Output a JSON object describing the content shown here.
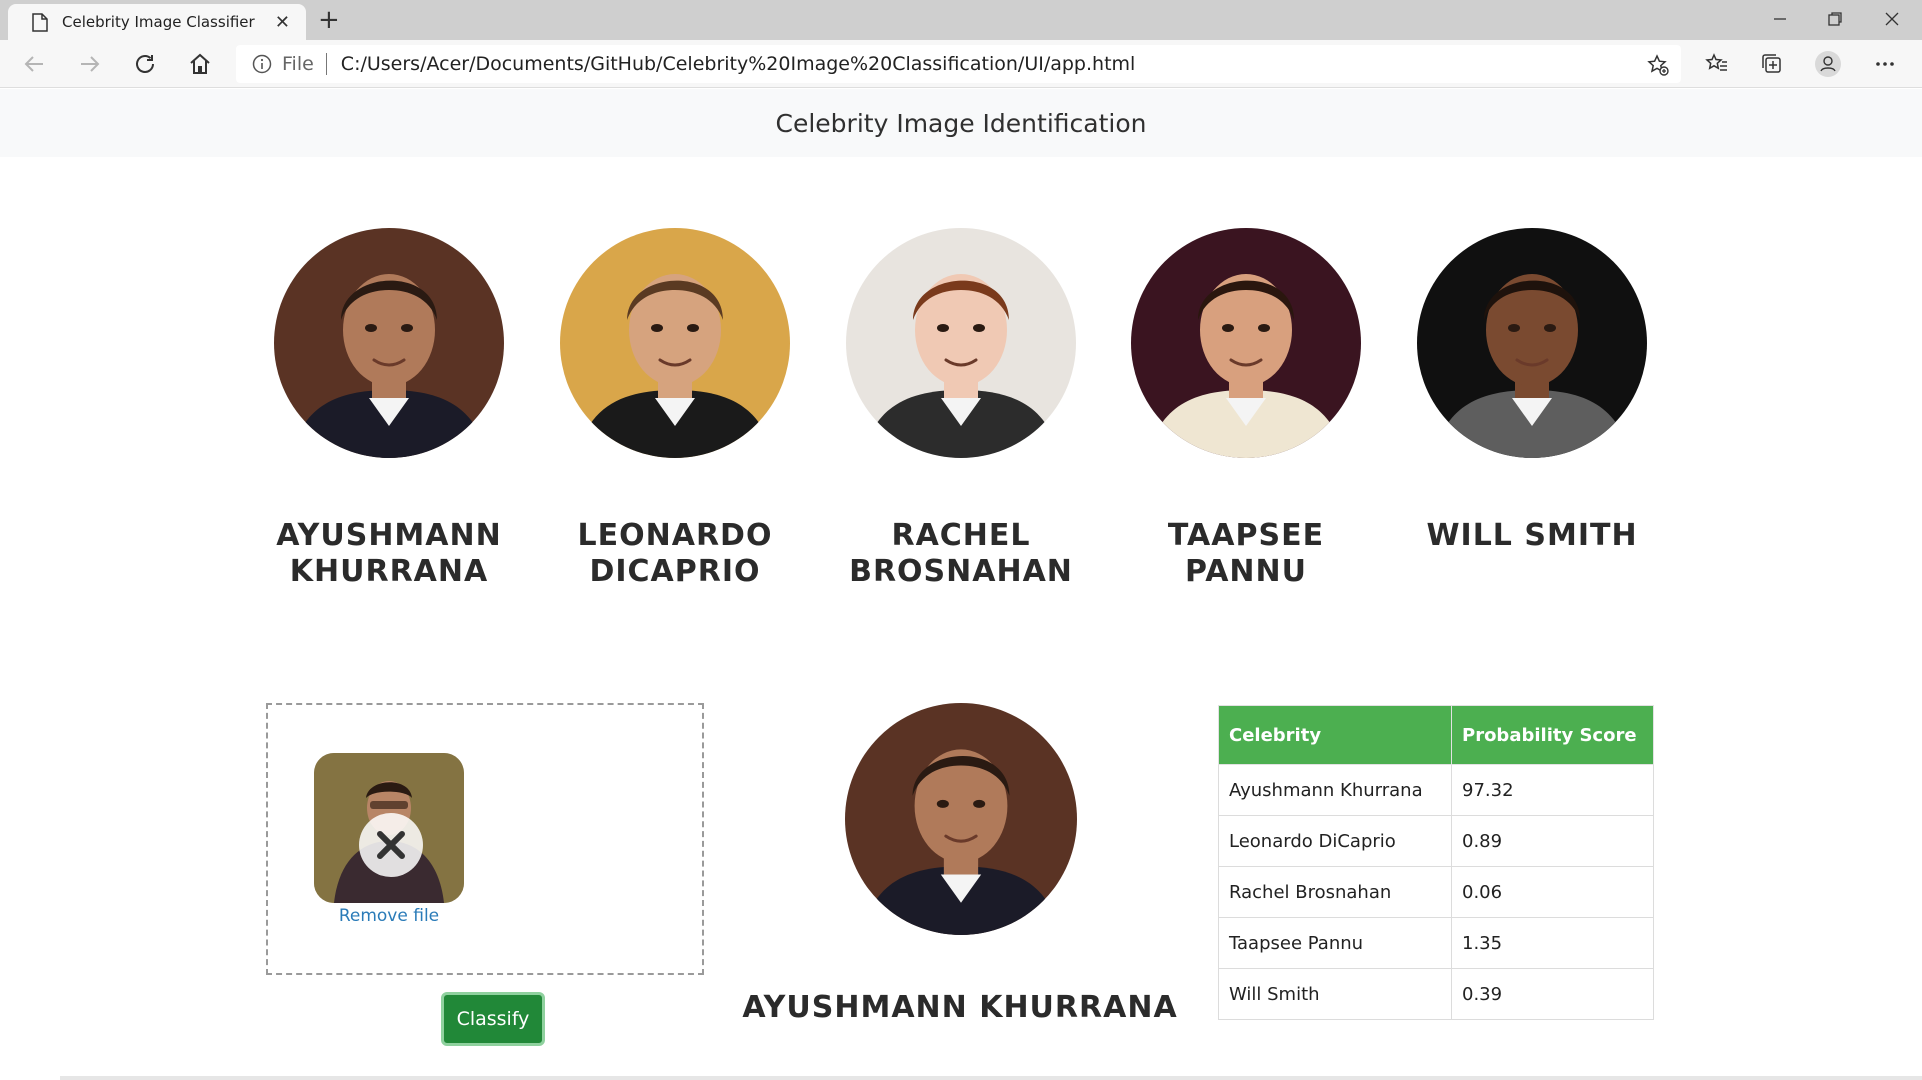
{
  "browser": {
    "tab_title": "Celebrity Image Classifier",
    "address_scheme_label": "File",
    "url": "C:/Users/Acer/Documents/GitHub/Celebrity%20Image%20Classification/UI/app.html"
  },
  "header": {
    "title": "Celebrity Image Identification"
  },
  "celebrities": [
    {
      "name_line1": "AYUSHMANN",
      "name_line2": "KHURRANA",
      "skin": "#b07a5a",
      "hair": "#2a1a12",
      "bg": "#5a3324",
      "suit": "#1b1b28"
    },
    {
      "name_line1": "LEONARDO",
      "name_line2": "DICAPRIO",
      "skin": "#d6a37e",
      "hair": "#5a3a22",
      "bg": "#d9a64a",
      "suit": "#1a1a1a"
    },
    {
      "name_line1": "RACHEL",
      "name_line2": "BROSNAHAN",
      "skin": "#f0c9b4",
      "hair": "#7a3a1c",
      "bg": "#e8e4df",
      "suit": "#2c2c2c"
    },
    {
      "name_line1": "TAAPSEE",
      "name_line2": "PANNU",
      "skin": "#d8a07e",
      "hair": "#2a160e",
      "bg": "#3a1420",
      "suit": "#efe6d2"
    },
    {
      "name_line1": "WILL SMITH",
      "name_line2": "",
      "skin": "#7a4a30",
      "hair": "#1e120c",
      "bg": "#101010",
      "suit": "#5e5e5e"
    }
  ],
  "upload": {
    "remove_label": "Remove file"
  },
  "classify_label": "Classify",
  "result": {
    "name": "AYUSHMANN KHURRANA"
  },
  "scores": {
    "headers": [
      "Celebrity",
      "Probability Score"
    ],
    "rows": [
      [
        "Ayushmann Khurrana",
        "97.32"
      ],
      [
        "Leonardo DiCaprio",
        "0.89"
      ],
      [
        "Rachel Brosnahan",
        "0.06"
      ],
      [
        "Taapsee Pannu",
        "1.35"
      ],
      [
        "Will Smith",
        "0.39"
      ]
    ]
  },
  "colors": {
    "accent_green": "#4caf50",
    "button_green": "#218838",
    "link_blue": "#2a7bb8"
  }
}
